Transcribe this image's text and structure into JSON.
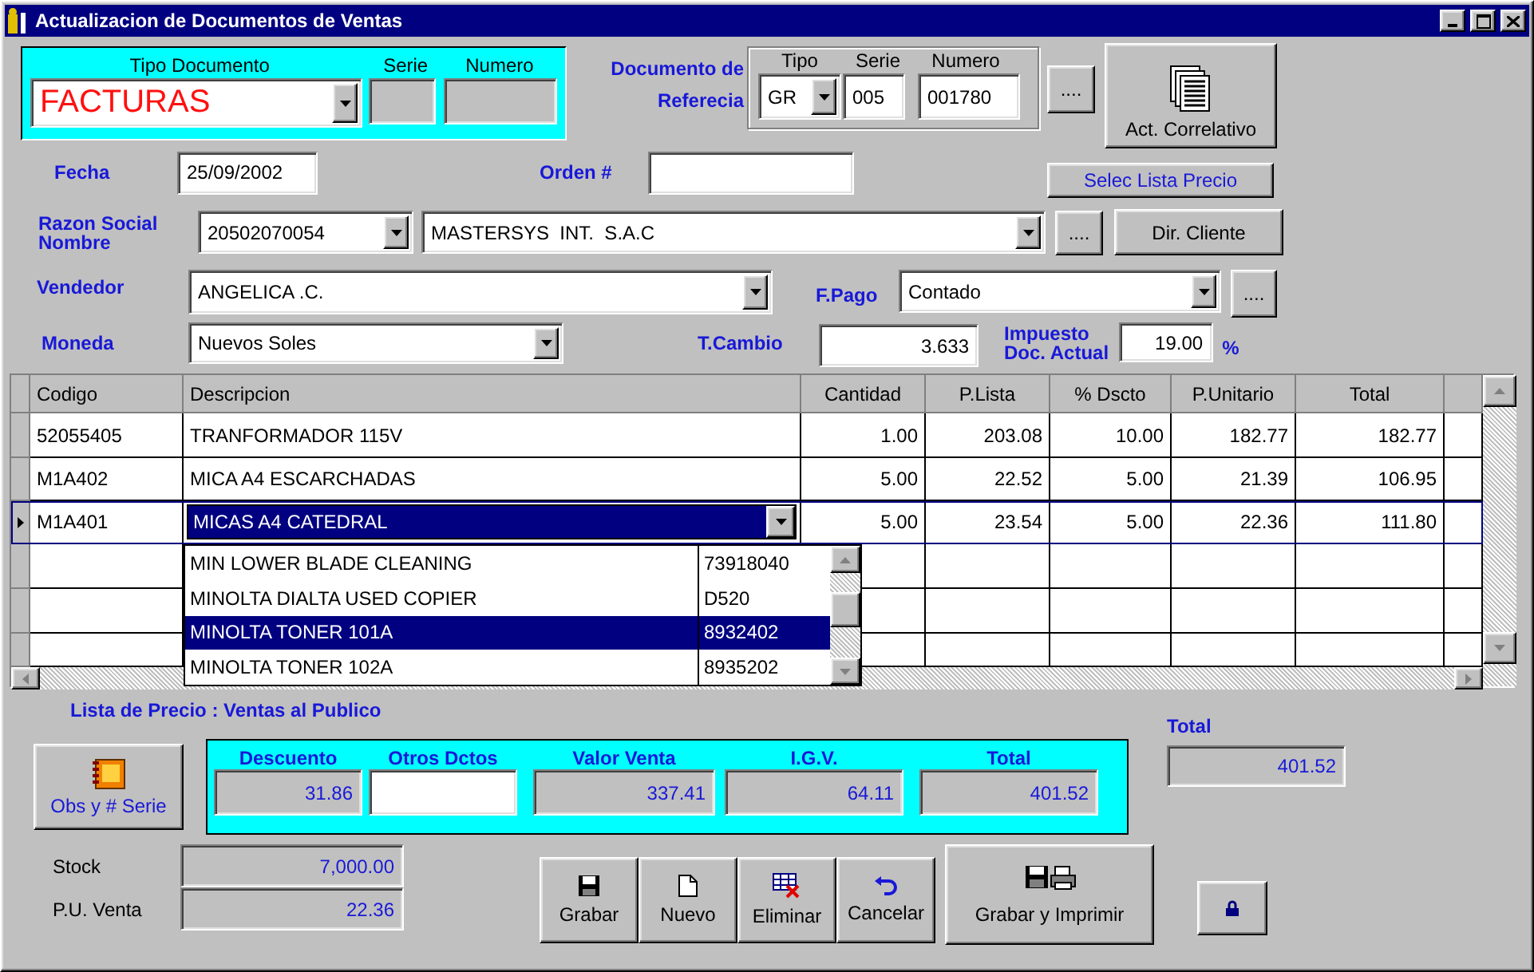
{
  "window": {
    "title": "Actualizacion de Documentos de Ventas"
  },
  "document_type": {
    "label": "Tipo Documento",
    "value": "FACTURAS",
    "serie_label": "Serie",
    "numero_label": "Numero"
  },
  "reference": {
    "label_1": "Documento de",
    "label_2": "Referecia",
    "tipo_label": "Tipo",
    "serie_label": "Serie",
    "numero_label": "Numero",
    "tipo": "GR",
    "serie": "005",
    "numero": "001780",
    "browse_button": "...."
  },
  "correlative_button": "Act. Correlativo",
  "fecha": {
    "label": "Fecha",
    "value": "25/09/2002"
  },
  "orden": {
    "label": "Orden #"
  },
  "price_list_button": "Selec Lista Precio",
  "client": {
    "label_1": "Razon Social",
    "label_2": "Nombre",
    "ruc": "20502070054",
    "name": "MASTERSYS  INT.  S.A.C",
    "browse_button": "....",
    "address_button": "Dir. Cliente"
  },
  "vendedor": {
    "label": "Vendedor",
    "value": "ANGELICA .C."
  },
  "pago": {
    "label": "F.Pago",
    "value": "Contado",
    "browse_button": "...."
  },
  "moneda": {
    "label": "Moneda",
    "value": "Nuevos Soles"
  },
  "cambio": {
    "label": "T.Cambio",
    "value": "3.633"
  },
  "impuesto": {
    "label_1": "Impuesto",
    "label_2": "Doc. Actual",
    "value": "19.00",
    "unit": "%"
  },
  "table": {
    "columns": [
      "Codigo",
      "Descripcion",
      "Cantidad",
      "P.Lista",
      "% Dscto",
      "P.Unitario",
      "Total"
    ],
    "rows": [
      {
        "selected": false,
        "cells": [
          "52055405",
          "TRANFORMADOR 115V",
          "1.00",
          "203.08",
          "10.00",
          "182.77",
          "182.77"
        ]
      },
      {
        "selected": false,
        "cells": [
          "M1A402",
          "MICA A4 ESCARCHADAS",
          "5.00",
          "22.52",
          "5.00",
          "21.39",
          "106.95"
        ]
      },
      {
        "selected": true,
        "cells": [
          "M1A401",
          "MICAS A4 CATEDRAL",
          "5.00",
          "23.54",
          "5.00",
          "22.36",
          "111.80"
        ]
      }
    ]
  },
  "lookup": {
    "items": [
      {
        "name": "MIN LOWER BLADE CLEANING",
        "code": "73918040",
        "selected": false
      },
      {
        "name": "MINOLTA DIALTA USED COPIER",
        "code": "D520",
        "selected": false
      },
      {
        "name": "MINOLTA TONER 101A",
        "code": "8932402",
        "selected": true
      },
      {
        "name": "MINOLTA TONER 102A",
        "code": "8935202",
        "selected": false
      }
    ]
  },
  "price_list": "Lista de Precio : Ventas al Publico",
  "summary": {
    "fields": [
      {
        "label": "Descuento",
        "value": "31.86",
        "kind": "readonly"
      },
      {
        "label": "Otros Dctos",
        "kind": "input"
      },
      {
        "label": "Valor Venta",
        "value": "337.41",
        "kind": "readonly"
      },
      {
        "label": "I.G.V.",
        "value": "64.11",
        "kind": "readonly"
      },
      {
        "label": "Total",
        "value": "401.52",
        "kind": "readonly"
      }
    ]
  },
  "total": {
    "label": "Total",
    "value": "401.52"
  },
  "obs_button": "Obs y # Serie",
  "stock": {
    "label": "Stock",
    "value": "7,000.00"
  },
  "pu_venta": {
    "label": "P.U. Venta",
    "value": "22.36"
  },
  "actions": [
    {
      "label": "Grabar",
      "kind": "save"
    },
    {
      "label": "Nuevo",
      "kind": "new"
    },
    {
      "label": "Eliminar",
      "kind": "delete"
    },
    {
      "label": "Cancelar",
      "kind": "undo"
    }
  ],
  "print_button": "Grabar y Imprimir"
}
